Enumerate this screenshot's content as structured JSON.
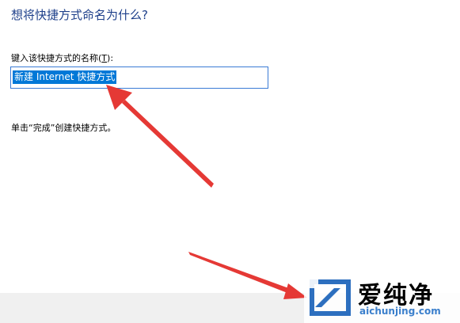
{
  "dialog": {
    "title": "想将快捷方式命名为什么?",
    "field_label_text": "键入该快捷方式的名称(",
    "field_label_accel": "T",
    "field_label_suffix": "):",
    "name_value": "新建 Internet 快捷方式",
    "hint": "单击“完成”创建快捷方式。"
  },
  "watermark": {
    "brand_cn": "爱纯净",
    "url": "aichunjing.com"
  },
  "colors": {
    "title": "#1d3f8a",
    "selection": "#0078d7",
    "input_border": "#3a7bd5",
    "annotation_arrow": "#e53935",
    "footer_bar": "#f0f0f0"
  }
}
